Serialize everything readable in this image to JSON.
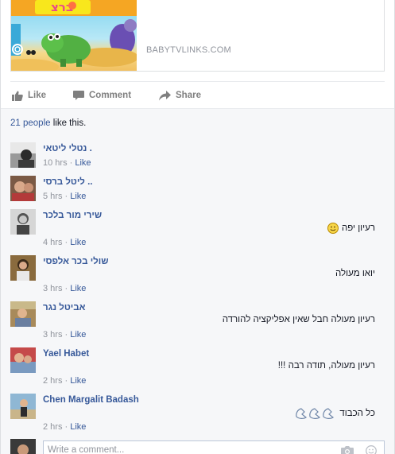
{
  "preview": {
    "thumbnail_text": "ברצ",
    "domain": "BABYTVLINKS.COM"
  },
  "actions": {
    "like": "Like",
    "comment": "Comment",
    "share": "Share"
  },
  "likes": {
    "count_text": "21 people",
    "suffix": " like this."
  },
  "comments": [
    {
      "name": "נטלי ליטאי .",
      "text": "",
      "time": "10 hrs",
      "like": "Like"
    },
    {
      "name": "ליטל ברסי ..",
      "text": "",
      "time": "5 hrs",
      "like": "Like"
    },
    {
      "name": "שירי מור בלכר",
      "text": "רעיון יפה",
      "emoji": "smiley",
      "time": "4 hrs",
      "like": "Like"
    },
    {
      "name": "שולי בכר אלפסי",
      "text": "יואו מעולה",
      "time": "3 hrs",
      "like": "Like"
    },
    {
      "name": "אביטל נגר",
      "text": "רעיון מעולה חבל שאין אפליקציה להורדה",
      "time": "3 hrs",
      "like": "Like"
    },
    {
      "name": "Yael Habet",
      "text": "רעיון מעולה, תודה רבה !!!",
      "time": "2 hrs",
      "like": "Like"
    },
    {
      "name": "Chen Margalit Badash",
      "text": "כל הכבוד",
      "emoji": "applause",
      "time": "2 hrs",
      "like": "Like"
    }
  ],
  "composer": {
    "placeholder": "Write a comment..."
  },
  "colors": {
    "link": "#365899",
    "muted": "#90949c",
    "panel_bg": "#f6f7f9"
  }
}
